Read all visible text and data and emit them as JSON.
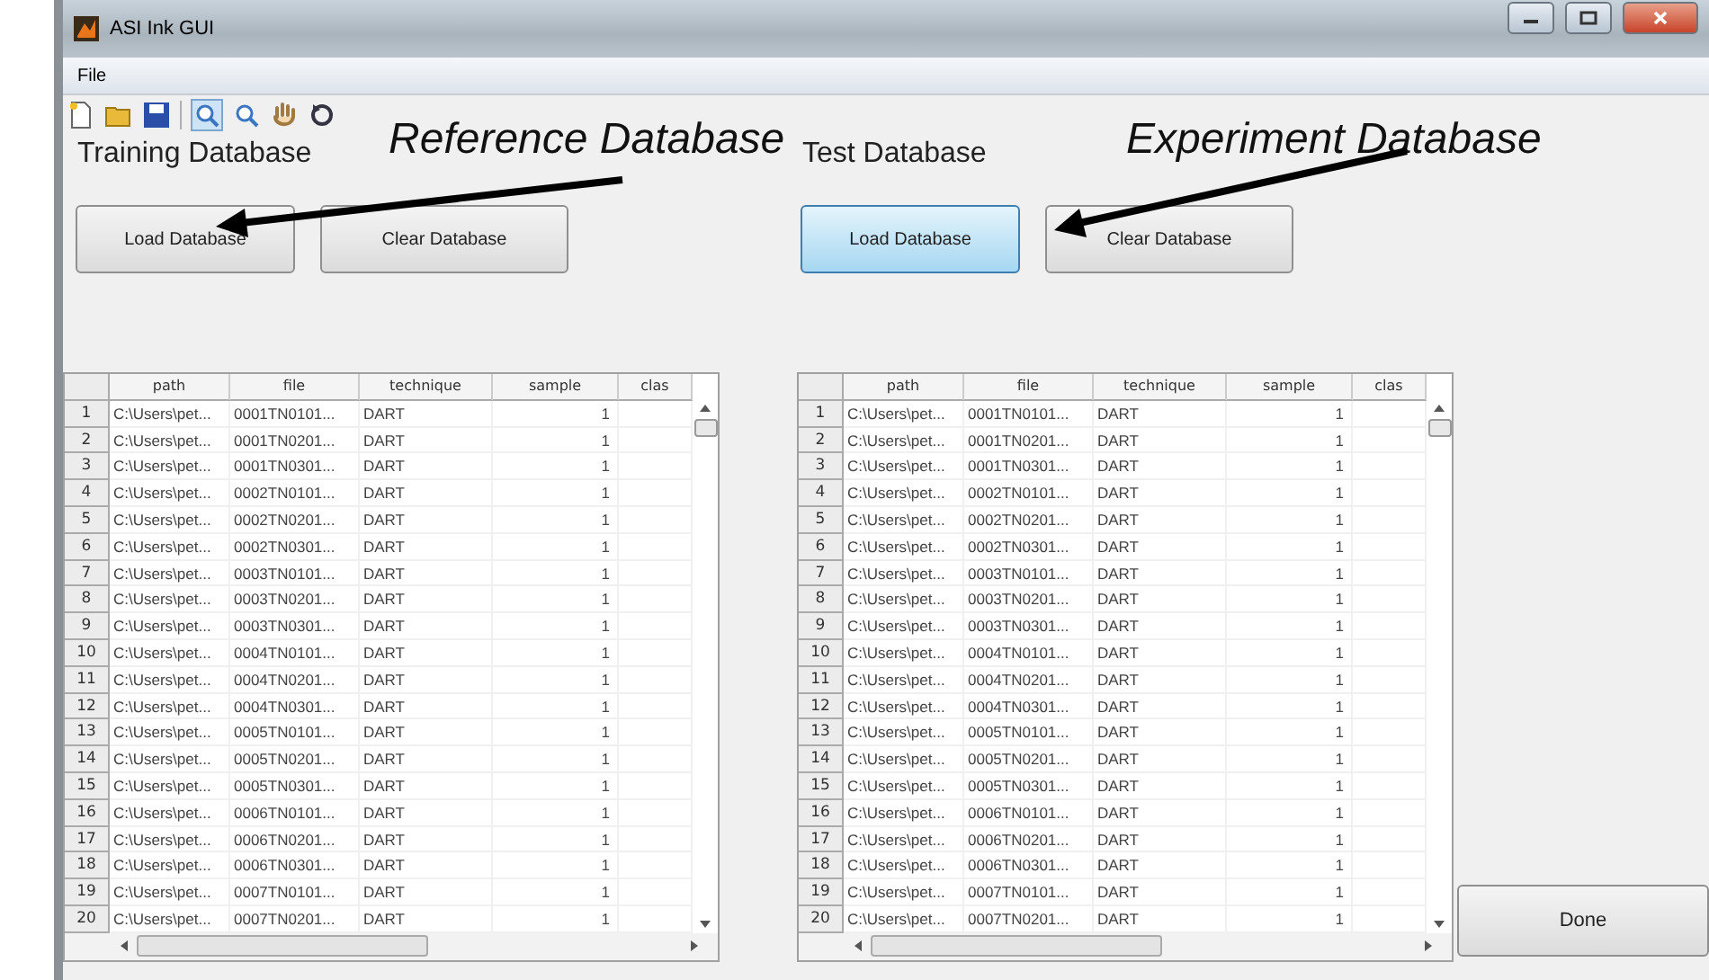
{
  "window": {
    "title": "ASI Ink GUI"
  },
  "menu": [
    "File"
  ],
  "annotations": [
    {
      "label": "Reference Database"
    },
    {
      "label": "Experiment Database"
    }
  ],
  "panels": [
    {
      "title": "Training Database",
      "buttons": [
        {
          "label": "Load Database",
          "focused": false
        },
        {
          "label": "Clear Database",
          "focused": false
        }
      ],
      "table": {
        "columns": [
          "path",
          "file",
          "technique",
          "sample",
          "clas"
        ],
        "rows": [
          {
            "index": "1",
            "path": "C:\\Users\\pet...",
            "file": "0001TN0101...",
            "technique": "DART",
            "sample": "1"
          },
          {
            "index": "2",
            "path": "C:\\Users\\pet...",
            "file": "0001TN0201...",
            "technique": "DART",
            "sample": "1"
          },
          {
            "index": "3",
            "path": "C:\\Users\\pet...",
            "file": "0001TN0301...",
            "technique": "DART",
            "sample": "1"
          },
          {
            "index": "4",
            "path": "C:\\Users\\pet...",
            "file": "0002TN0101...",
            "technique": "DART",
            "sample": "1"
          },
          {
            "index": "5",
            "path": "C:\\Users\\pet...",
            "file": "0002TN0201...",
            "technique": "DART",
            "sample": "1"
          },
          {
            "index": "6",
            "path": "C:\\Users\\pet...",
            "file": "0002TN0301...",
            "technique": "DART",
            "sample": "1"
          },
          {
            "index": "7",
            "path": "C:\\Users\\pet...",
            "file": "0003TN0101...",
            "technique": "DART",
            "sample": "1"
          },
          {
            "index": "8",
            "path": "C:\\Users\\pet...",
            "file": "0003TN0201...",
            "technique": "DART",
            "sample": "1"
          },
          {
            "index": "9",
            "path": "C:\\Users\\pet...",
            "file": "0003TN0301...",
            "technique": "DART",
            "sample": "1"
          },
          {
            "index": "10",
            "path": "C:\\Users\\pet...",
            "file": "0004TN0101...",
            "technique": "DART",
            "sample": "1"
          },
          {
            "index": "11",
            "path": "C:\\Users\\pet...",
            "file": "0004TN0201...",
            "technique": "DART",
            "sample": "1"
          },
          {
            "index": "12",
            "path": "C:\\Users\\pet...",
            "file": "0004TN0301...",
            "technique": "DART",
            "sample": "1"
          },
          {
            "index": "13",
            "path": "C:\\Users\\pet...",
            "file": "0005TN0101...",
            "technique": "DART",
            "sample": "1"
          },
          {
            "index": "14",
            "path": "C:\\Users\\pet...",
            "file": "0005TN0201...",
            "technique": "DART",
            "sample": "1"
          },
          {
            "index": "15",
            "path": "C:\\Users\\pet...",
            "file": "0005TN0301...",
            "technique": "DART",
            "sample": "1"
          },
          {
            "index": "16",
            "path": "C:\\Users\\pet...",
            "file": "0006TN0101...",
            "technique": "DART",
            "sample": "1"
          },
          {
            "index": "17",
            "path": "C:\\Users\\pet...",
            "file": "0006TN0201...",
            "technique": "DART",
            "sample": "1"
          },
          {
            "index": "18",
            "path": "C:\\Users\\pet...",
            "file": "0006TN0301...",
            "technique": "DART",
            "sample": "1"
          },
          {
            "index": "19",
            "path": "C:\\Users\\pet...",
            "file": "0007TN0101...",
            "technique": "DART",
            "sample": "1"
          },
          {
            "index": "20",
            "path": "C:\\Users\\pet...",
            "file": "0007TN0201...",
            "technique": "DART",
            "sample": "1"
          }
        ]
      }
    },
    {
      "title": "Test Database",
      "buttons": [
        {
          "label": "Load Database",
          "focused": true
        },
        {
          "label": "Clear Database",
          "focused": false
        }
      ],
      "table": {
        "columns": [
          "path",
          "file",
          "technique",
          "sample",
          "clas"
        ],
        "rows": [
          {
            "index": "1",
            "path": "C:\\Users\\pet...",
            "file": "0001TN0101...",
            "technique": "DART",
            "sample": "1"
          },
          {
            "index": "2",
            "path": "C:\\Users\\pet...",
            "file": "0001TN0201...",
            "technique": "DART",
            "sample": "1"
          },
          {
            "index": "3",
            "path": "C:\\Users\\pet...",
            "file": "0001TN0301...",
            "technique": "DART",
            "sample": "1"
          },
          {
            "index": "4",
            "path": "C:\\Users\\pet...",
            "file": "0002TN0101...",
            "technique": "DART",
            "sample": "1"
          },
          {
            "index": "5",
            "path": "C:\\Users\\pet...",
            "file": "0002TN0201...",
            "technique": "DART",
            "sample": "1"
          },
          {
            "index": "6",
            "path": "C:\\Users\\pet...",
            "file": "0002TN0301...",
            "technique": "DART",
            "sample": "1"
          },
          {
            "index": "7",
            "path": "C:\\Users\\pet...",
            "file": "0003TN0101...",
            "technique": "DART",
            "sample": "1"
          },
          {
            "index": "8",
            "path": "C:\\Users\\pet...",
            "file": "0003TN0201...",
            "technique": "DART",
            "sample": "1"
          },
          {
            "index": "9",
            "path": "C:\\Users\\pet...",
            "file": "0003TN0301...",
            "technique": "DART",
            "sample": "1"
          },
          {
            "index": "10",
            "path": "C:\\Users\\pet...",
            "file": "0004TN0101...",
            "technique": "DART",
            "sample": "1"
          },
          {
            "index": "11",
            "path": "C:\\Users\\pet...",
            "file": "0004TN0201...",
            "technique": "DART",
            "sample": "1"
          },
          {
            "index": "12",
            "path": "C:\\Users\\pet...",
            "file": "0004TN0301...",
            "technique": "DART",
            "sample": "1"
          },
          {
            "index": "13",
            "path": "C:\\Users\\pet...",
            "file": "0005TN0101...",
            "technique": "DART",
            "sample": "1"
          },
          {
            "index": "14",
            "path": "C:\\Users\\pet...",
            "file": "0005TN0201...",
            "technique": "DART",
            "sample": "1"
          },
          {
            "index": "15",
            "path": "C:\\Users\\pet...",
            "file": "0005TN0301...",
            "technique": "DART",
            "sample": "1"
          },
          {
            "index": "16",
            "path": "C:\\Users\\pet...",
            "file": "0006TN0101...",
            "technique": "DART",
            "sample": "1"
          },
          {
            "index": "17",
            "path": "C:\\Users\\pet...",
            "file": "0006TN0201...",
            "technique": "DART",
            "sample": "1"
          },
          {
            "index": "18",
            "path": "C:\\Users\\pet...",
            "file": "0006TN0301...",
            "technique": "DART",
            "sample": "1"
          },
          {
            "index": "19",
            "path": "C:\\Users\\pet...",
            "file": "0007TN0101...",
            "technique": "DART",
            "sample": "1"
          },
          {
            "index": "20",
            "path": "C:\\Users\\pet...",
            "file": "0007TN0201...",
            "technique": "DART",
            "sample": "1"
          }
        ]
      }
    }
  ],
  "done_button": {
    "label": "Done"
  }
}
